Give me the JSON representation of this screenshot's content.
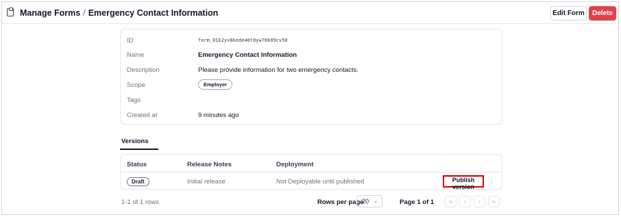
{
  "header": {
    "breadcrumb_root": "Manage Forms",
    "breadcrumb_sep": "/",
    "breadcrumb_current": "Emergency Contact Information",
    "edit_label": "Edit Form",
    "delete_label": "Delete",
    "icon": "clipboard-icon"
  },
  "details": {
    "id_label": "ID",
    "id_value": "form_01k2yv8kede40t0yw70k89cv50",
    "name_label": "Name",
    "name_value": "Emergency Contact Information",
    "description_label": "Description",
    "description_value": "Please provide information for two emergency contacts.",
    "scope_label": "Scope",
    "scope_value": "Employer",
    "tags_label": "Tags",
    "created_label": "Created at",
    "created_value": "9 minutes ago"
  },
  "versions": {
    "tab_label": "Versions",
    "columns": [
      "Status",
      "Release Notes",
      "Deployment"
    ],
    "rows": [
      {
        "status": "Draft",
        "release_notes": "Initial release",
        "deployment": "Not Deployable until published",
        "action": "Publish version"
      }
    ]
  },
  "pagination": {
    "rows_info": "1-1 of 1 rows",
    "rows_per_page_label": "Rows per page",
    "rows_per_page_value": "20",
    "page_info": "Page 1 of 1",
    "first_icon": "«",
    "prev_icon": "‹",
    "next_icon": "›",
    "last_icon": "»"
  },
  "colors": {
    "delete": "#e0414a",
    "highlight_border": "#d00000"
  }
}
